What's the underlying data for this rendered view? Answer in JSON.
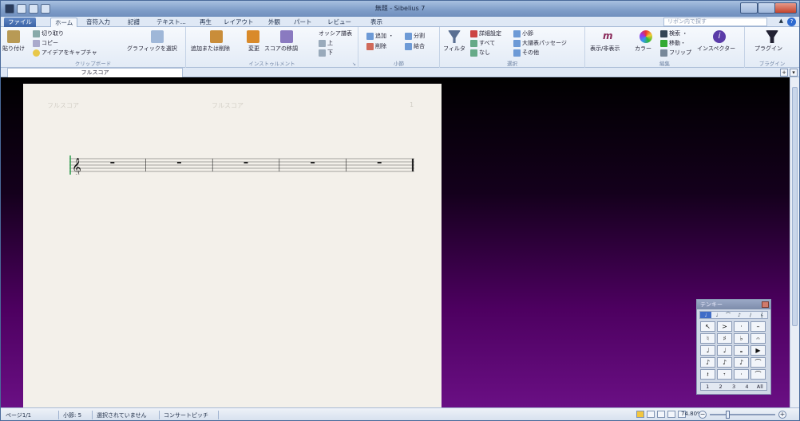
{
  "window": {
    "title": "無題 - Sibelius 7"
  },
  "ribbon_tabs": [
    "ファイル",
    "ホーム",
    "音符入力",
    "記譜",
    "テキスト...",
    "再生",
    "レイアウト",
    "外観",
    "パート",
    "レビュー",
    "表示"
  ],
  "ribbon_search_placeholder": "リボン内で探す",
  "groups": {
    "clipboard": {
      "label": "クリップボード",
      "paste": "貼り付け",
      "cut": "切り取り",
      "copy": "コピー",
      "capture": "アイデアをキャプチャ",
      "select_graphic": "グラフィックを選択"
    },
    "instruments": {
      "label": "インストゥルメント",
      "add_remove": "追加または削除",
      "change": "変更",
      "transpose": "スコアの移調",
      "ossia": "オッシア譜表",
      "up": "上",
      "down": "下"
    },
    "bars": {
      "label": "小節",
      "add": "追加 ・",
      "split": "分割",
      "delete": "削除",
      "join": "結合"
    },
    "select": {
      "label": "選択",
      "filter": "フィルタ",
      "advanced": "詳細設定",
      "all": "すべて",
      "none": "なし",
      "bar": "小節",
      "system_passage": "大譜表パッセージ",
      "other": "その他"
    },
    "edit": {
      "label": "編集",
      "show_hide": "表示/非表示",
      "color": "カラー",
      "find": "検索 ・",
      "goto": "移動・",
      "flip": "フリップ",
      "inspector": "インスペクター"
    },
    "plugins": {
      "label": "プラグイン",
      "plugins": "プラグイン"
    }
  },
  "document_tab": "フルスコア",
  "score": {
    "header_left": "フルスコア",
    "header_center": "フルスコア",
    "page_number": "1",
    "clef": "𝄞",
    "bars": 5
  },
  "keypad": {
    "title": "テンキー",
    "tabs": [
      "♩",
      "♩",
      "⌒",
      "♪",
      "/",
      "𝄞"
    ],
    "keys": [
      "↖",
      ">",
      "·",
      "–",
      "♮",
      "♯",
      "♭",
      "𝄐",
      "♩",
      "♩",
      "𝅝",
      "▶",
      "♪",
      "♪",
      "♪",
      "⌒",
      "𝄽",
      "𝄾",
      "·",
      "⌒"
    ],
    "layouts": [
      "1",
      "2",
      "3",
      "4",
      "All"
    ]
  },
  "status": {
    "page": "ページ1/1",
    "bar": "小節: 5",
    "selection": "選択されていません",
    "pitch": "コンサートピッチ",
    "zoom": "74.80%"
  },
  "colors": {
    "accent": "#3f6cc7",
    "canvas_bottom": "#6a0f84"
  }
}
